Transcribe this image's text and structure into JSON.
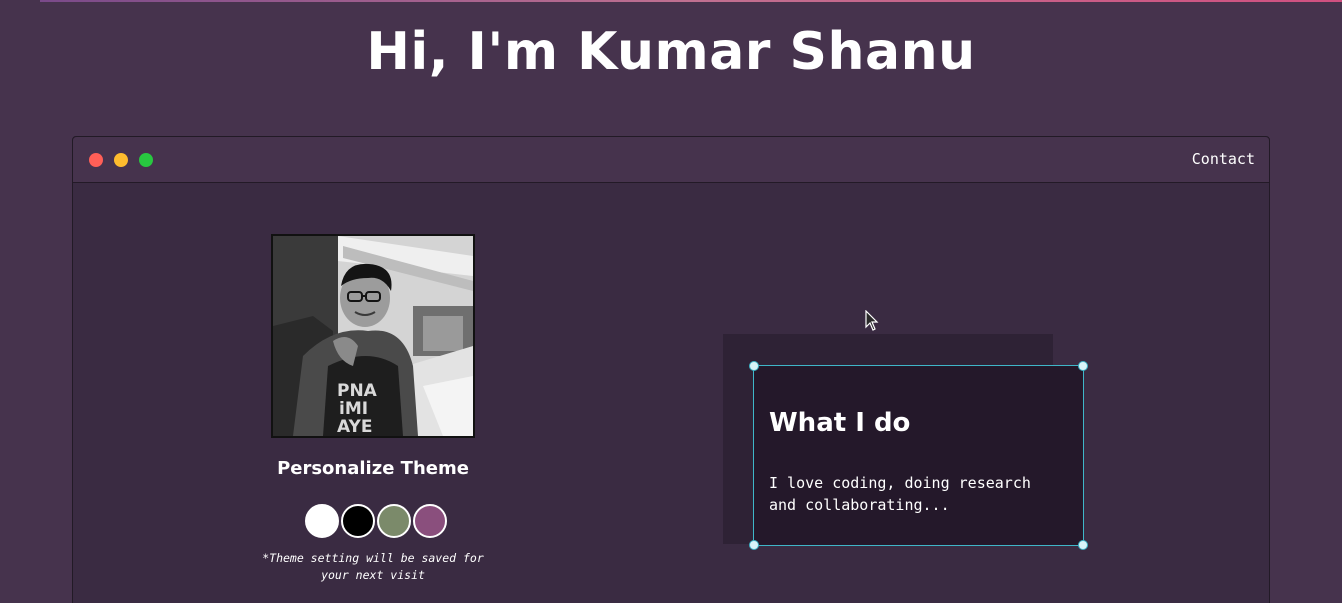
{
  "header": {
    "title": "Hi, I'm Kumar Shanu"
  },
  "window": {
    "controls": [
      "close",
      "minimize",
      "maximize"
    ],
    "nav": {
      "contact_label": "Contact"
    }
  },
  "profile": {
    "photo_icon": "profile-photo"
  },
  "theme": {
    "title": "Personalize Theme",
    "swatches": [
      {
        "name": "white",
        "color": "#ffffff"
      },
      {
        "name": "black",
        "color": "#000000"
      },
      {
        "name": "green",
        "color": "#7b8a6a"
      },
      {
        "name": "purple",
        "color": "#8a4f7d"
      }
    ],
    "note_line1": "*Theme setting will be saved for",
    "note_line2": "your next visit"
  },
  "card": {
    "title": "What I do",
    "text_line1": "I love coding, doing research",
    "text_line2": "and collaborating..."
  },
  "colors": {
    "background": "#46334d",
    "window_body": "#3a2b42",
    "card": "#24182a",
    "selection": "#3fb6c8"
  }
}
